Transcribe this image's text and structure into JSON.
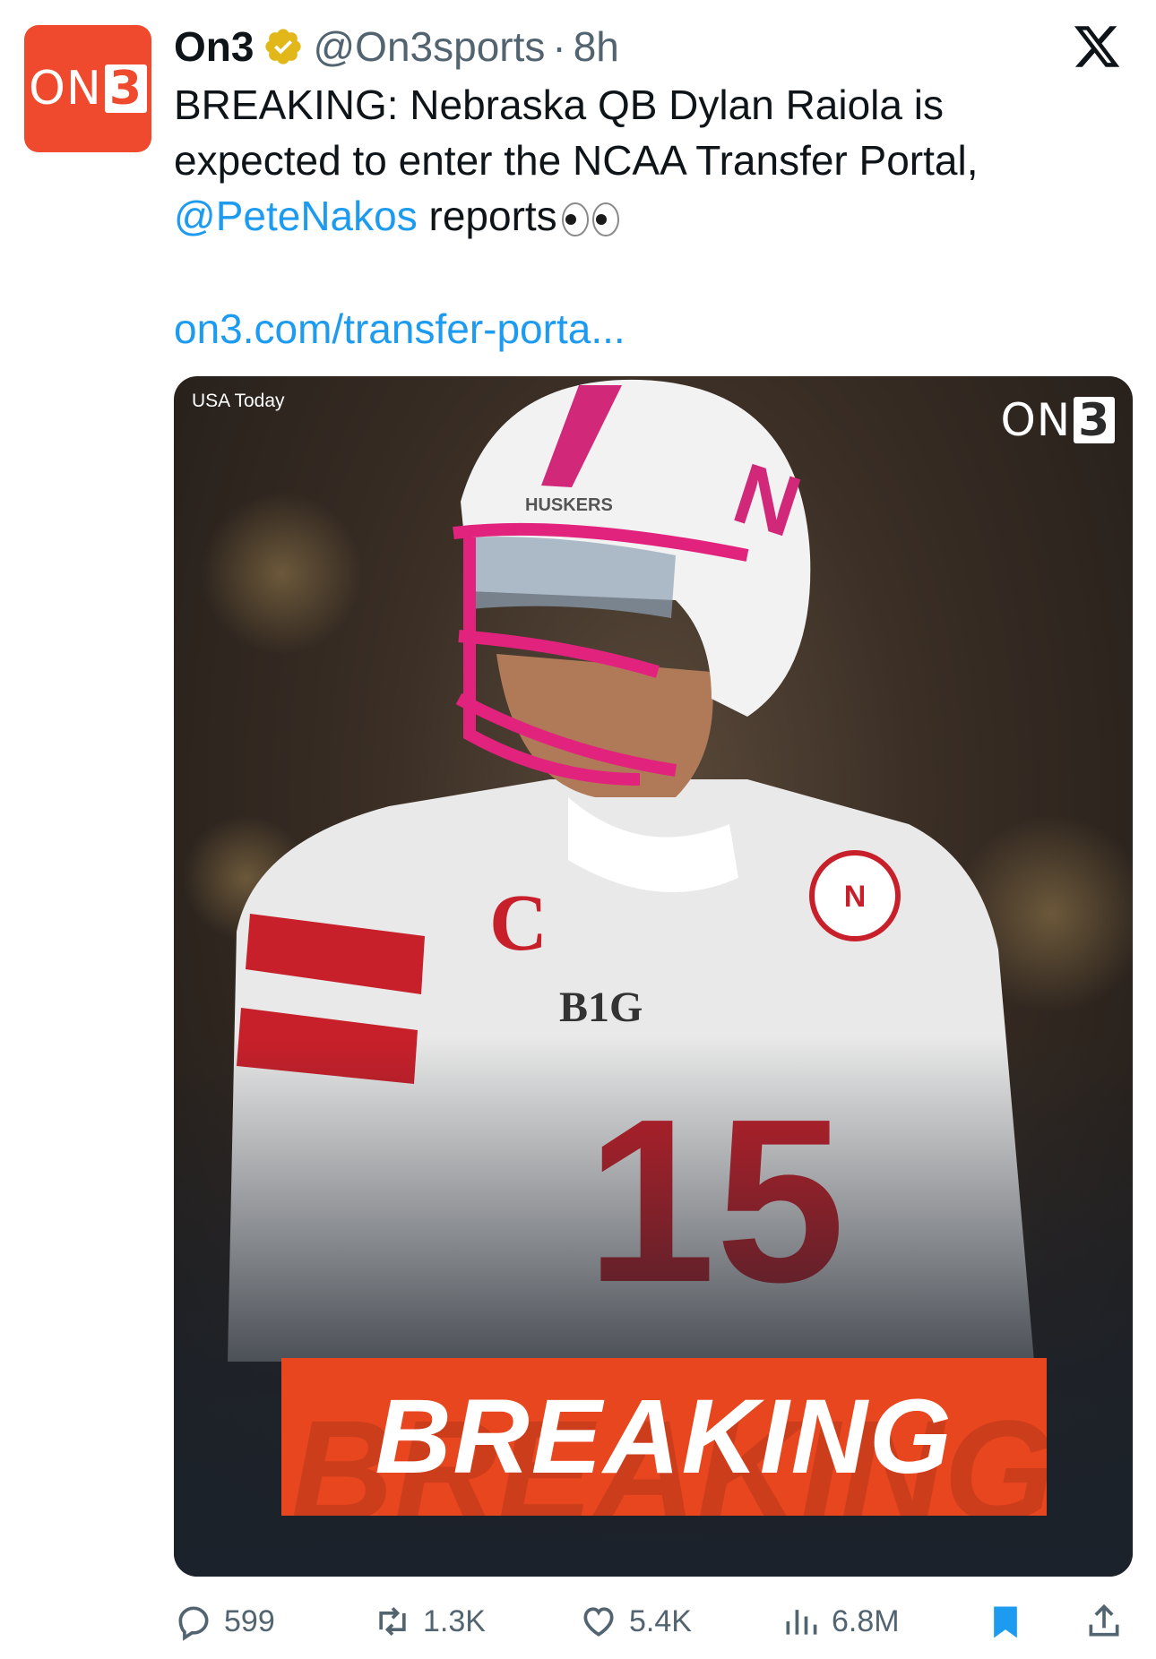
{
  "account": {
    "avatar_logo": "On3",
    "display_name": "On3",
    "handle": "@On3sports",
    "separator": "·",
    "time_ago": "8h",
    "verified_icon": "gold-verified-badge-icon",
    "verified_color": "#e2b719"
  },
  "platform_icon": "x-logo-icon",
  "tweet": {
    "text_main": "BREAKING: Nebraska QB Dylan Raiola is expected to enter the NCAA Transfer Portal,",
    "mention": "@PeteNakos",
    "text_tail": " reports",
    "emoji": "eyes-emoji",
    "link": "on3.com/transfer-porta..."
  },
  "media": {
    "photo_credit": "USA Today",
    "brand_logo": "On3",
    "banner_text": "BREAKING",
    "helmet_text": "HUSKERS",
    "conference_patch": "B1G",
    "jersey_number": "15",
    "captain_patch": "C",
    "banner_color": "#e8461f"
  },
  "actions": {
    "replies": "599",
    "retweets": "1.3K",
    "likes": "5.4K",
    "views": "6.8M"
  },
  "colors": {
    "accent": "#1d9bf0",
    "brand": "#ef4a2d",
    "secondary_text": "#536471"
  }
}
